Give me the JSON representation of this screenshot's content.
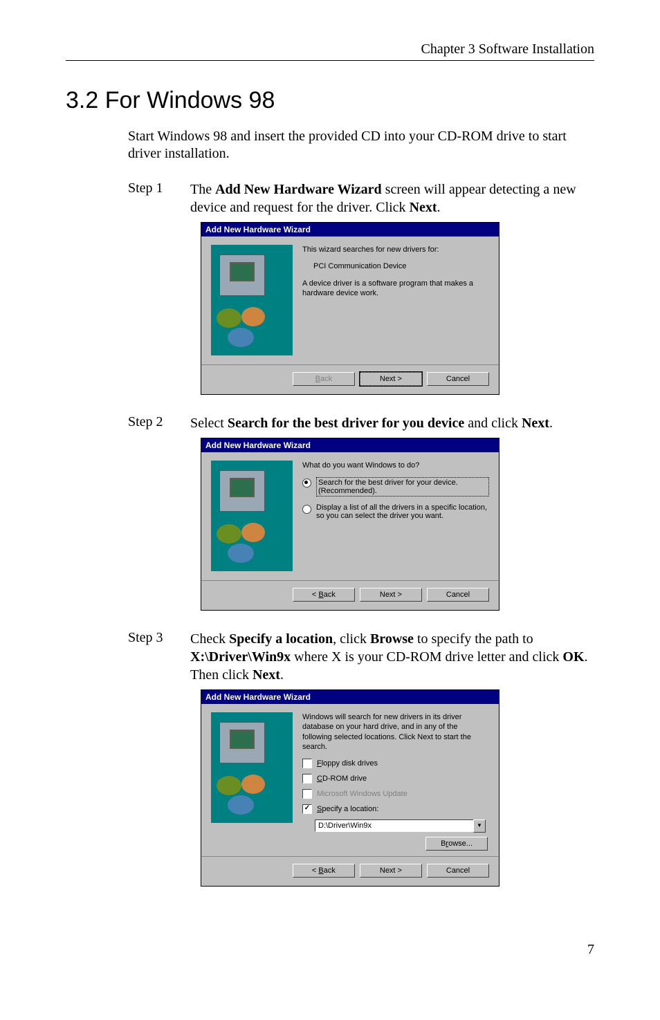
{
  "header": {
    "running": "Chapter 3  Software Installation"
  },
  "section": {
    "title": "3.2 For Windows 98"
  },
  "intro": "Start Windows 98 and insert the provided CD into your CD-ROM drive to start driver installation.",
  "steps": {
    "s1": {
      "label": "Step 1",
      "text_pre": "The ",
      "bold1": "Add New Hardware Wizard",
      "text_mid": " screen will appear detecting a new device and request for the driver. Click ",
      "bold2": "Next",
      "text_post": "."
    },
    "s2": {
      "label": "Step 2",
      "text_pre": "Select ",
      "bold1": "Search for the best driver for you device",
      "text_mid": " and click ",
      "bold2": "Next",
      "text_post": "."
    },
    "s3": {
      "label": "Step 3",
      "text_pre": "Check ",
      "bold1": "Specify a location",
      "text_mid1": ", click ",
      "bold2": "Browse",
      "text_mid2": " to specify the path to ",
      "bold3": "X:\\Driver\\Win9x",
      "text_mid3": " where X is your CD-ROM drive letter and click ",
      "bold4": "OK",
      "text_mid4": ". Then click ",
      "bold5": "Next",
      "text_post": "."
    }
  },
  "wizard": {
    "title": "Add New Hardware Wizard",
    "btn_back": "< Back",
    "btn_next": "Next >",
    "btn_cancel": "Cancel",
    "btn_browse": "Browse...",
    "w1": {
      "line1": "This wizard searches for new drivers for:",
      "line2": "PCI Communication Device",
      "line3": "A device driver is a software program that makes a hardware device work."
    },
    "w2": {
      "prompt": "What do you want Windows to do?",
      "opt1": "Search for the best driver for your device. (Recommended).",
      "opt2": "Display a list of all the drivers in a specific location, so you can select the driver you want."
    },
    "w3": {
      "intro": "Windows will search for new drivers in its driver database on your hard drive, and in any of the following selected locations. Click Next to start the search.",
      "chk_floppy": "Floppy disk drives",
      "chk_cdrom": "CD-ROM drive",
      "chk_msupdate": "Microsoft Windows Update",
      "chk_specify": "Specify a location:",
      "path_value": "D:\\Driver\\Win9x"
    }
  },
  "page_number": "7"
}
